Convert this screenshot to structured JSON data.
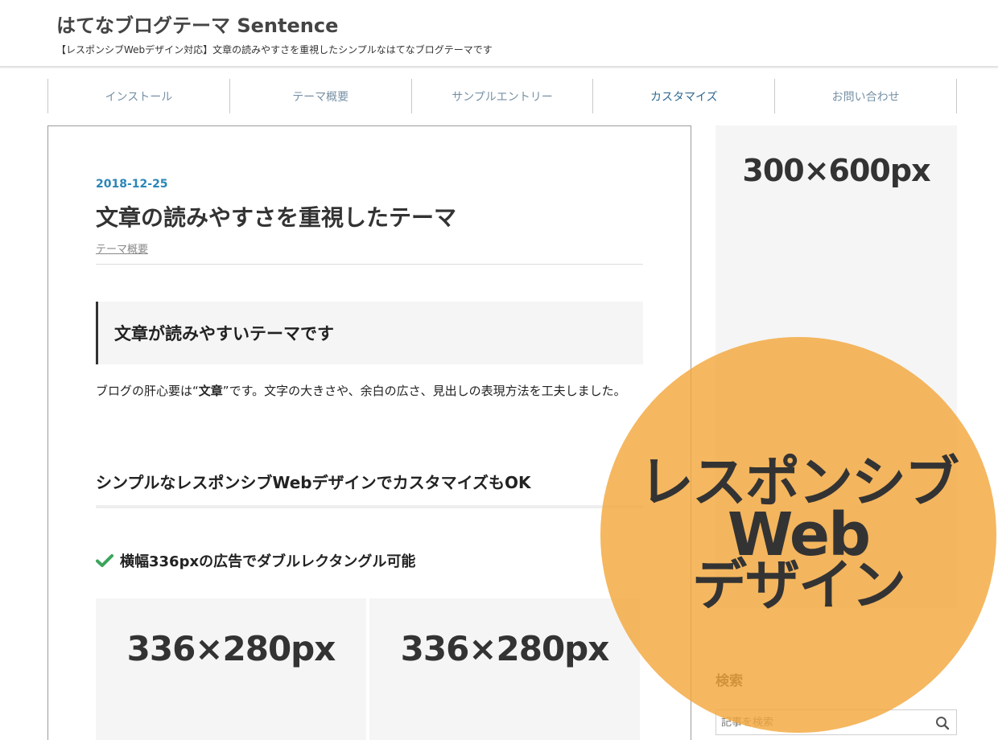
{
  "header": {
    "site_title": "はてなブログテーマ Sentence",
    "description": "【レスポンシブWebデザイン対応】文章の読みやすさを重視したシンプルなはてなブログテーマです"
  },
  "nav": {
    "items": [
      {
        "label": "インストール"
      },
      {
        "label": "テーマ概要"
      },
      {
        "label": "サンプルエントリー"
      },
      {
        "label": "カスタマイズ"
      },
      {
        "label": "お問い合わせ"
      }
    ]
  },
  "article": {
    "date": "2018-12-25",
    "title": "文章の読みやすさを重視したテーマ",
    "category": "テーマ概要",
    "h2": "文章が読みやすいテーマです",
    "paragraph": {
      "before": "ブログの肝心要は“",
      "bold": "文章",
      "after": "”です。文字の大きさや、余白の広さ、見出しの表現方法を工夫しました。"
    },
    "h3": "シンプルなレスポンシブWebデザインでカスタマイズもOK",
    "h4": "横幅336pxの広告でダブルレクタングル可能",
    "ad_left_label": "336×280px",
    "ad_right_label": "336×280px"
  },
  "sidebar": {
    "ad_label": "300×600px",
    "search_heading": "検索",
    "search_placeholder": "記事を検索"
  },
  "promo": {
    "line1": "レスポンシブ",
    "line2": "Web",
    "line3": "デザイン"
  },
  "colors": {
    "accent_date": "#2a86b8",
    "nav_text": "#7791a5",
    "nav_active": "#2f6892",
    "promo_orange": "#f3a73d",
    "check_green": "#3ba55c"
  },
  "icons": {
    "check": "check-icon",
    "search": "search-icon"
  }
}
